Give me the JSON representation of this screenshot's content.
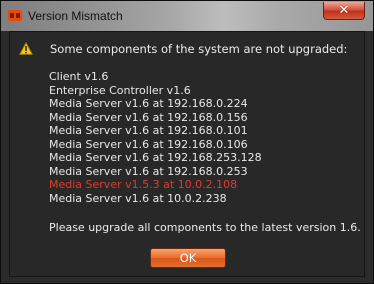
{
  "window": {
    "title": "Version Mismatch",
    "close_glyph": "✕",
    "app_icon": "network-optix-logo-icon",
    "close_color": "#c7361f"
  },
  "dialog": {
    "icon": "warning-icon",
    "headline": "Some components of the system are not upgraded:",
    "components": [
      {
        "text": "Client v1.6",
        "status": "ok"
      },
      {
        "text": "Enterprise Controller v1.6",
        "status": "ok"
      },
      {
        "text": "Media Server v1.6 at 192.168.0.224",
        "status": "ok"
      },
      {
        "text": "Media Server v1.6 at 192.168.0.156",
        "status": "ok"
      },
      {
        "text": "Media Server v1.6 at 192.168.0.101",
        "status": "ok"
      },
      {
        "text": "Media Server v1.6 at 192.168.0.106",
        "status": "ok"
      },
      {
        "text": "Media Server v1.6 at 192.168.253.128",
        "status": "ok"
      },
      {
        "text": "Media Server v1.6 at 192.168.0.253",
        "status": "ok"
      },
      {
        "text": "Media Server v1.5.3 at 10.0.2.108",
        "status": "mismatch"
      },
      {
        "text": "Media Server v1.6 at 10.0.2.238",
        "status": "ok"
      }
    ],
    "footer": "Please upgrade all components to the latest version 1.6.",
    "ok_label": "OK"
  },
  "colors": {
    "mismatch": "#e23b2e",
    "accent_button": "#e8692a",
    "text": "#e8e8e8",
    "background": "#282828"
  }
}
